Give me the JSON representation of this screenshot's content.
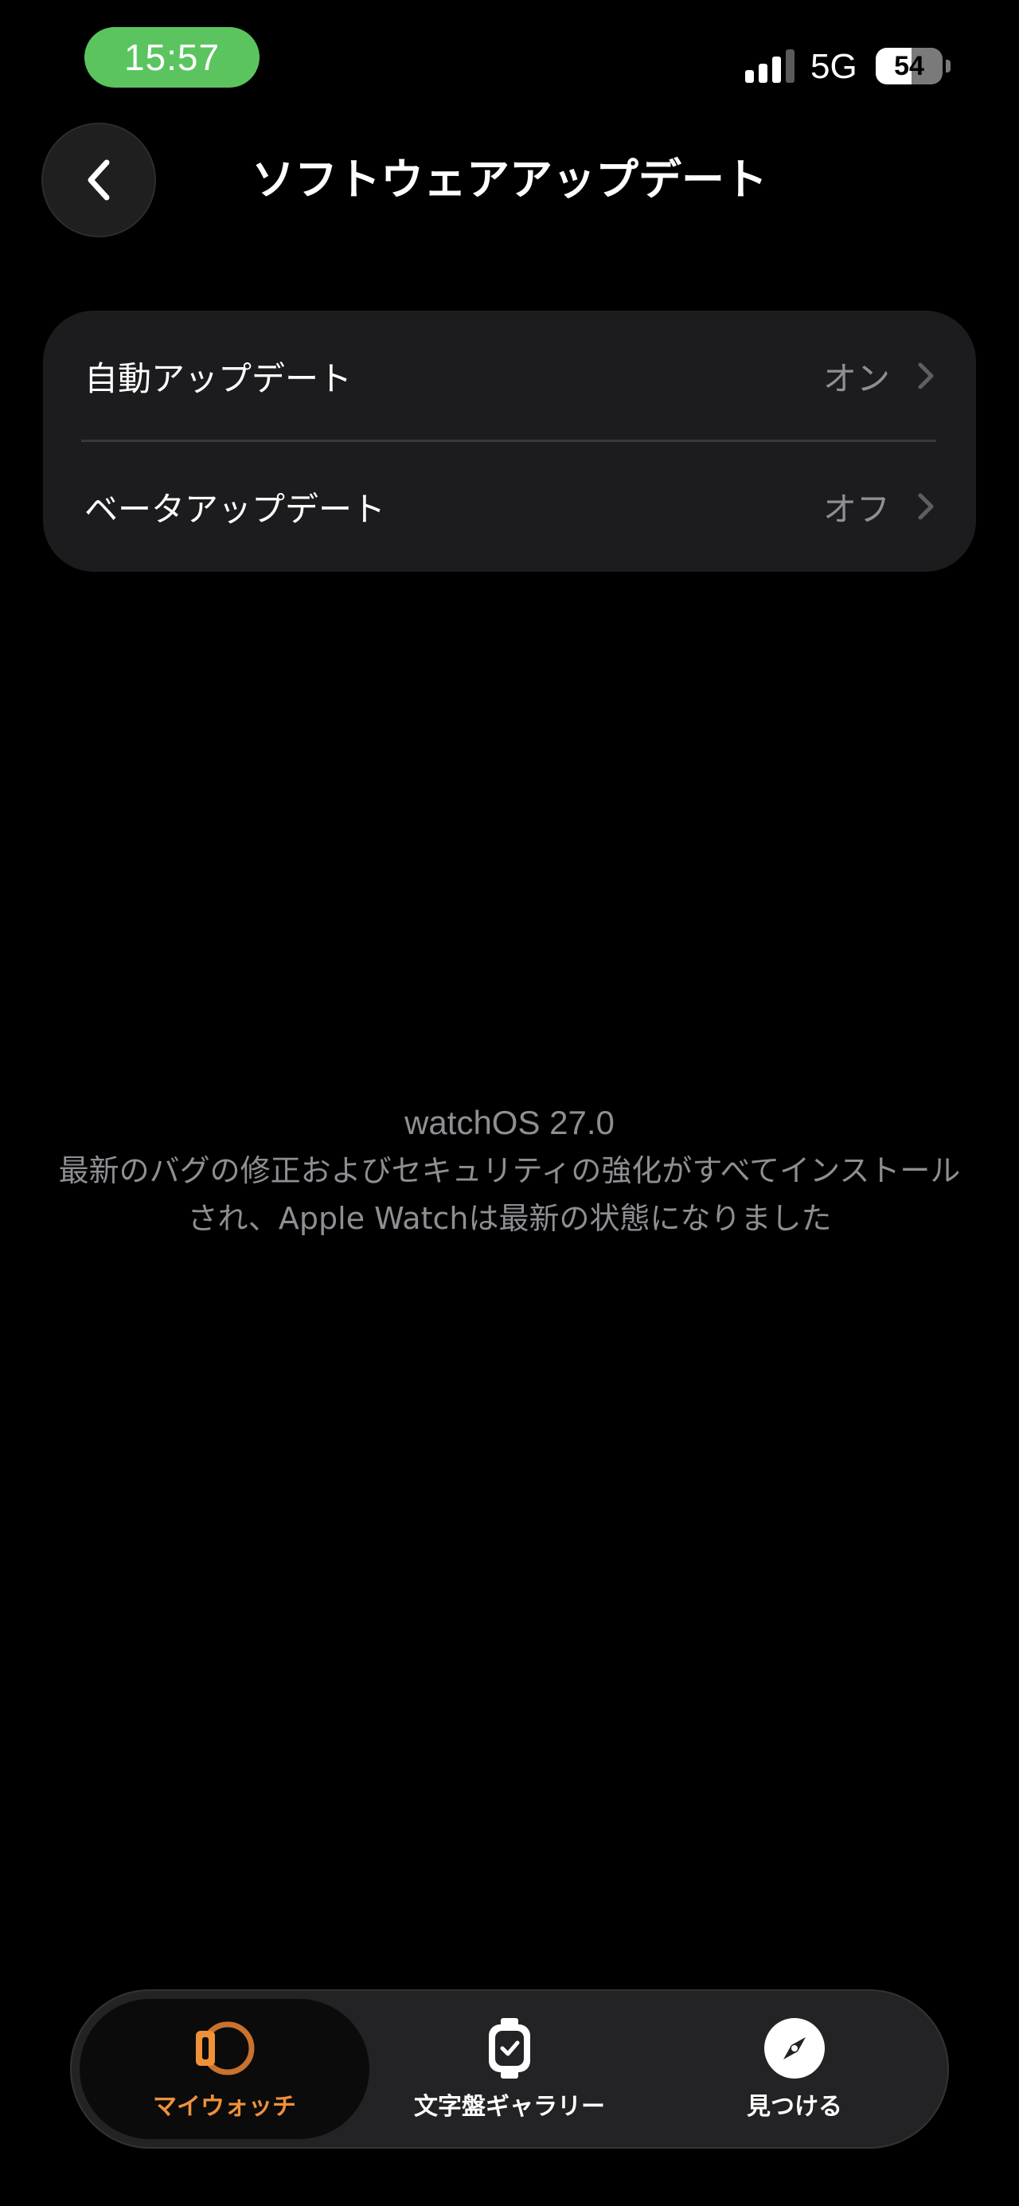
{
  "status_bar": {
    "time": "15:57",
    "network": "5G",
    "battery_level": 54,
    "battery_text": "54"
  },
  "nav": {
    "title": "ソフトウェアアップデート"
  },
  "settings": [
    {
      "label": "自動アップデート",
      "value": "オン"
    },
    {
      "label": "ベータアップデート",
      "value": "オフ"
    }
  ],
  "info": {
    "version": "watchOS 27.0",
    "line1": "最新のバグの修正およびセキュリティの強化がすべてインストール",
    "line2": "され、Apple Watchは最新の状態になりました"
  },
  "tabs": [
    {
      "label": "マイウォッチ",
      "icon": "watch-icon",
      "active": true
    },
    {
      "label": "文字盤ギャラリー",
      "icon": "watch-face-icon",
      "active": false
    },
    {
      "label": "見つける",
      "icon": "compass-icon",
      "active": false
    }
  ],
  "colors": {
    "time_pill": "#5bc45f",
    "accent": "#f0913a",
    "secondary_text": "#8e8e93",
    "card": "#1c1c1e"
  }
}
